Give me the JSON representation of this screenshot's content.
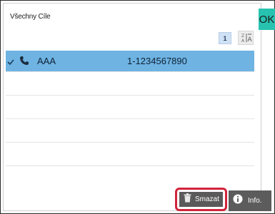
{
  "header": {
    "title": "Všechny Cíle",
    "ok_label": "OK"
  },
  "pager": {
    "page": "1"
  },
  "list": {
    "rows": [
      {
        "name": "AAA",
        "number": "1-1234567890",
        "selected": true
      }
    ]
  },
  "footer": {
    "delete_label": "Smazat",
    "info_label": "Info."
  },
  "colors": {
    "accent_ok": "#27c2b0",
    "selected_row": "#6eb3e2",
    "highlight_border": "#d1243a",
    "button_dark": "#5a5a5a"
  },
  "icons": [
    "check-icon",
    "phone-icon",
    "sort-icon",
    "trash-icon",
    "info-icon"
  ]
}
